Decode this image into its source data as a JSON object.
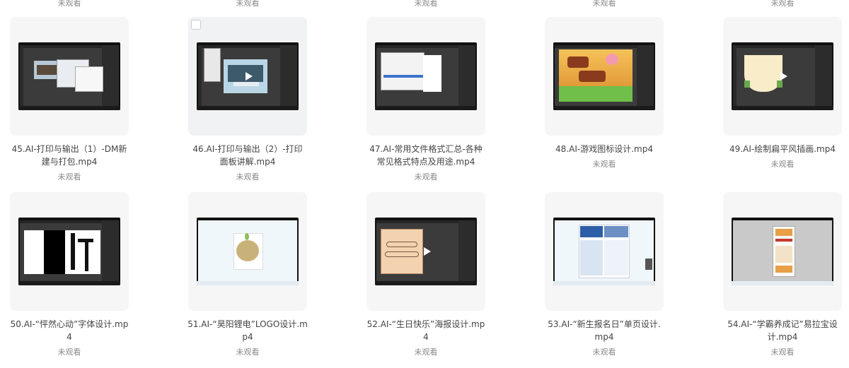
{
  "top_status": [
    "未观看",
    "未观看",
    "未观看",
    "未观看",
    "未观看"
  ],
  "items": [
    {
      "title_l1": "45.AI-打印与输出（1）-DM新",
      "title_l2": "建与打包.mp4",
      "status": "未观看",
      "thumb_icon": "ai-print-dm-thumbnail"
    },
    {
      "title_l1": "46.AI-打印与输出（2）-打印",
      "title_l2": "面板讲解.mp4",
      "status": "未观看",
      "thumb_icon": "ai-print-panel-thumbnail"
    },
    {
      "title_l1": "47.AI-常用文件格式汇总-各种",
      "title_l2": "常见格式特点及用途.mp4",
      "status": "未观看",
      "thumb_icon": "ai-file-format-thumbnail"
    },
    {
      "title_l1": "48.AI-游戏图标设计.mp4",
      "title_l2": "",
      "status": "未观看",
      "thumb_icon": "ai-game-icon-thumbnail"
    },
    {
      "title_l1": "49.AI-绘制扁平风插画.mp4",
      "title_l2": "",
      "status": "未观看",
      "thumb_icon": "ai-flat-illustration-thumbnail"
    },
    {
      "title_l1": "50.AI-“怦然心动”字体设计.mp",
      "title_l2": "4",
      "status": "未观看",
      "thumb_icon": "ai-font-design-thumbnail"
    },
    {
      "title_l1": "51.AI-“昊阳锂电”LOGO设计.m",
      "title_l2": "p4",
      "status": "未观看",
      "thumb_icon": "ai-logo-design-thumbnail"
    },
    {
      "title_l1": "52.AI-“生日快乐”海报设计.mp",
      "title_l2": "4",
      "status": "未观看",
      "thumb_icon": "ai-birthday-poster-thumbnail"
    },
    {
      "title_l1": "53.AI-“新生报名日”单页设计.",
      "title_l2": "mp4",
      "status": "未观看",
      "thumb_icon": "ai-flyer-design-thumbnail"
    },
    {
      "title_l1": "54.AI-“学霸养成记”易拉宝设",
      "title_l2": "计.mp4",
      "status": "未观看",
      "thumb_icon": "ai-rollup-banner-thumbnail"
    }
  ],
  "colors": {
    "tile_bg": "#f6f6f7",
    "status_text": "#8a8a8a",
    "title_text": "#444444"
  }
}
